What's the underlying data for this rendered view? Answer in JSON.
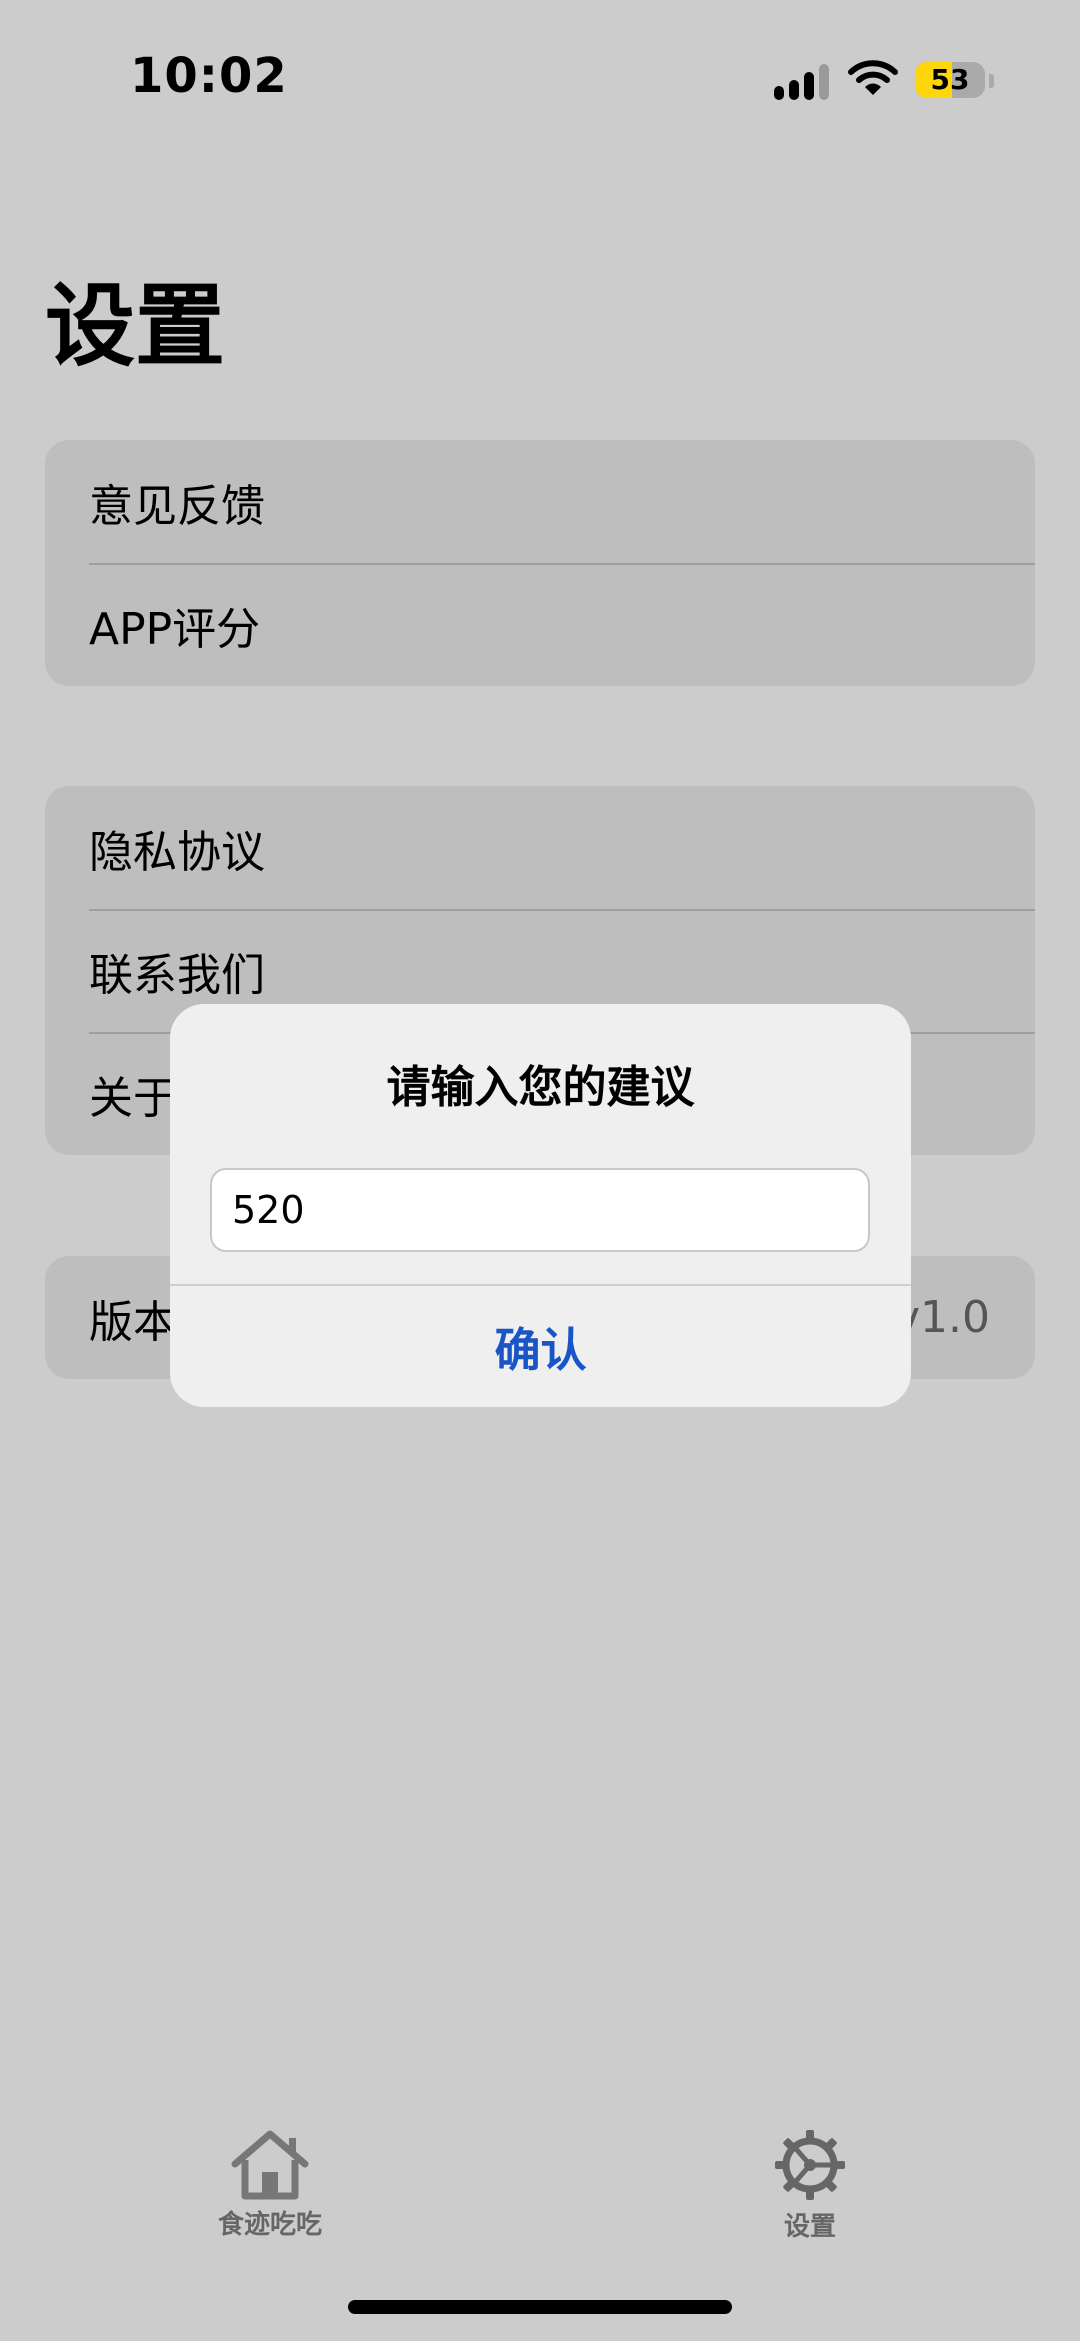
{
  "status_bar": {
    "time": "10:02",
    "battery_level": "53",
    "battery_fraction": 0.53,
    "battery_color": "#ffd60a",
    "signal_icon": "cellular-signal-icon",
    "wifi_icon": "wifi-icon"
  },
  "page": {
    "title": "设置"
  },
  "groups": {
    "feedback": {
      "label": "意见反馈"
    },
    "rating": {
      "label": "APP评分"
    },
    "privacy": {
      "label": "隐私协议"
    },
    "contact": {
      "label": "联系我们"
    },
    "about": {
      "label": "关于"
    },
    "version": {
      "label": "版本",
      "value": "v1.0"
    }
  },
  "dialog": {
    "title": "请输入您的建议",
    "input_value": "520",
    "confirm_label": "确认",
    "accent_color": "#1a55c6"
  },
  "tab_bar": {
    "home": {
      "label": "食迹吃吃",
      "icon": "home-icon"
    },
    "settings": {
      "label": "设置",
      "icon": "gear-icon"
    }
  }
}
